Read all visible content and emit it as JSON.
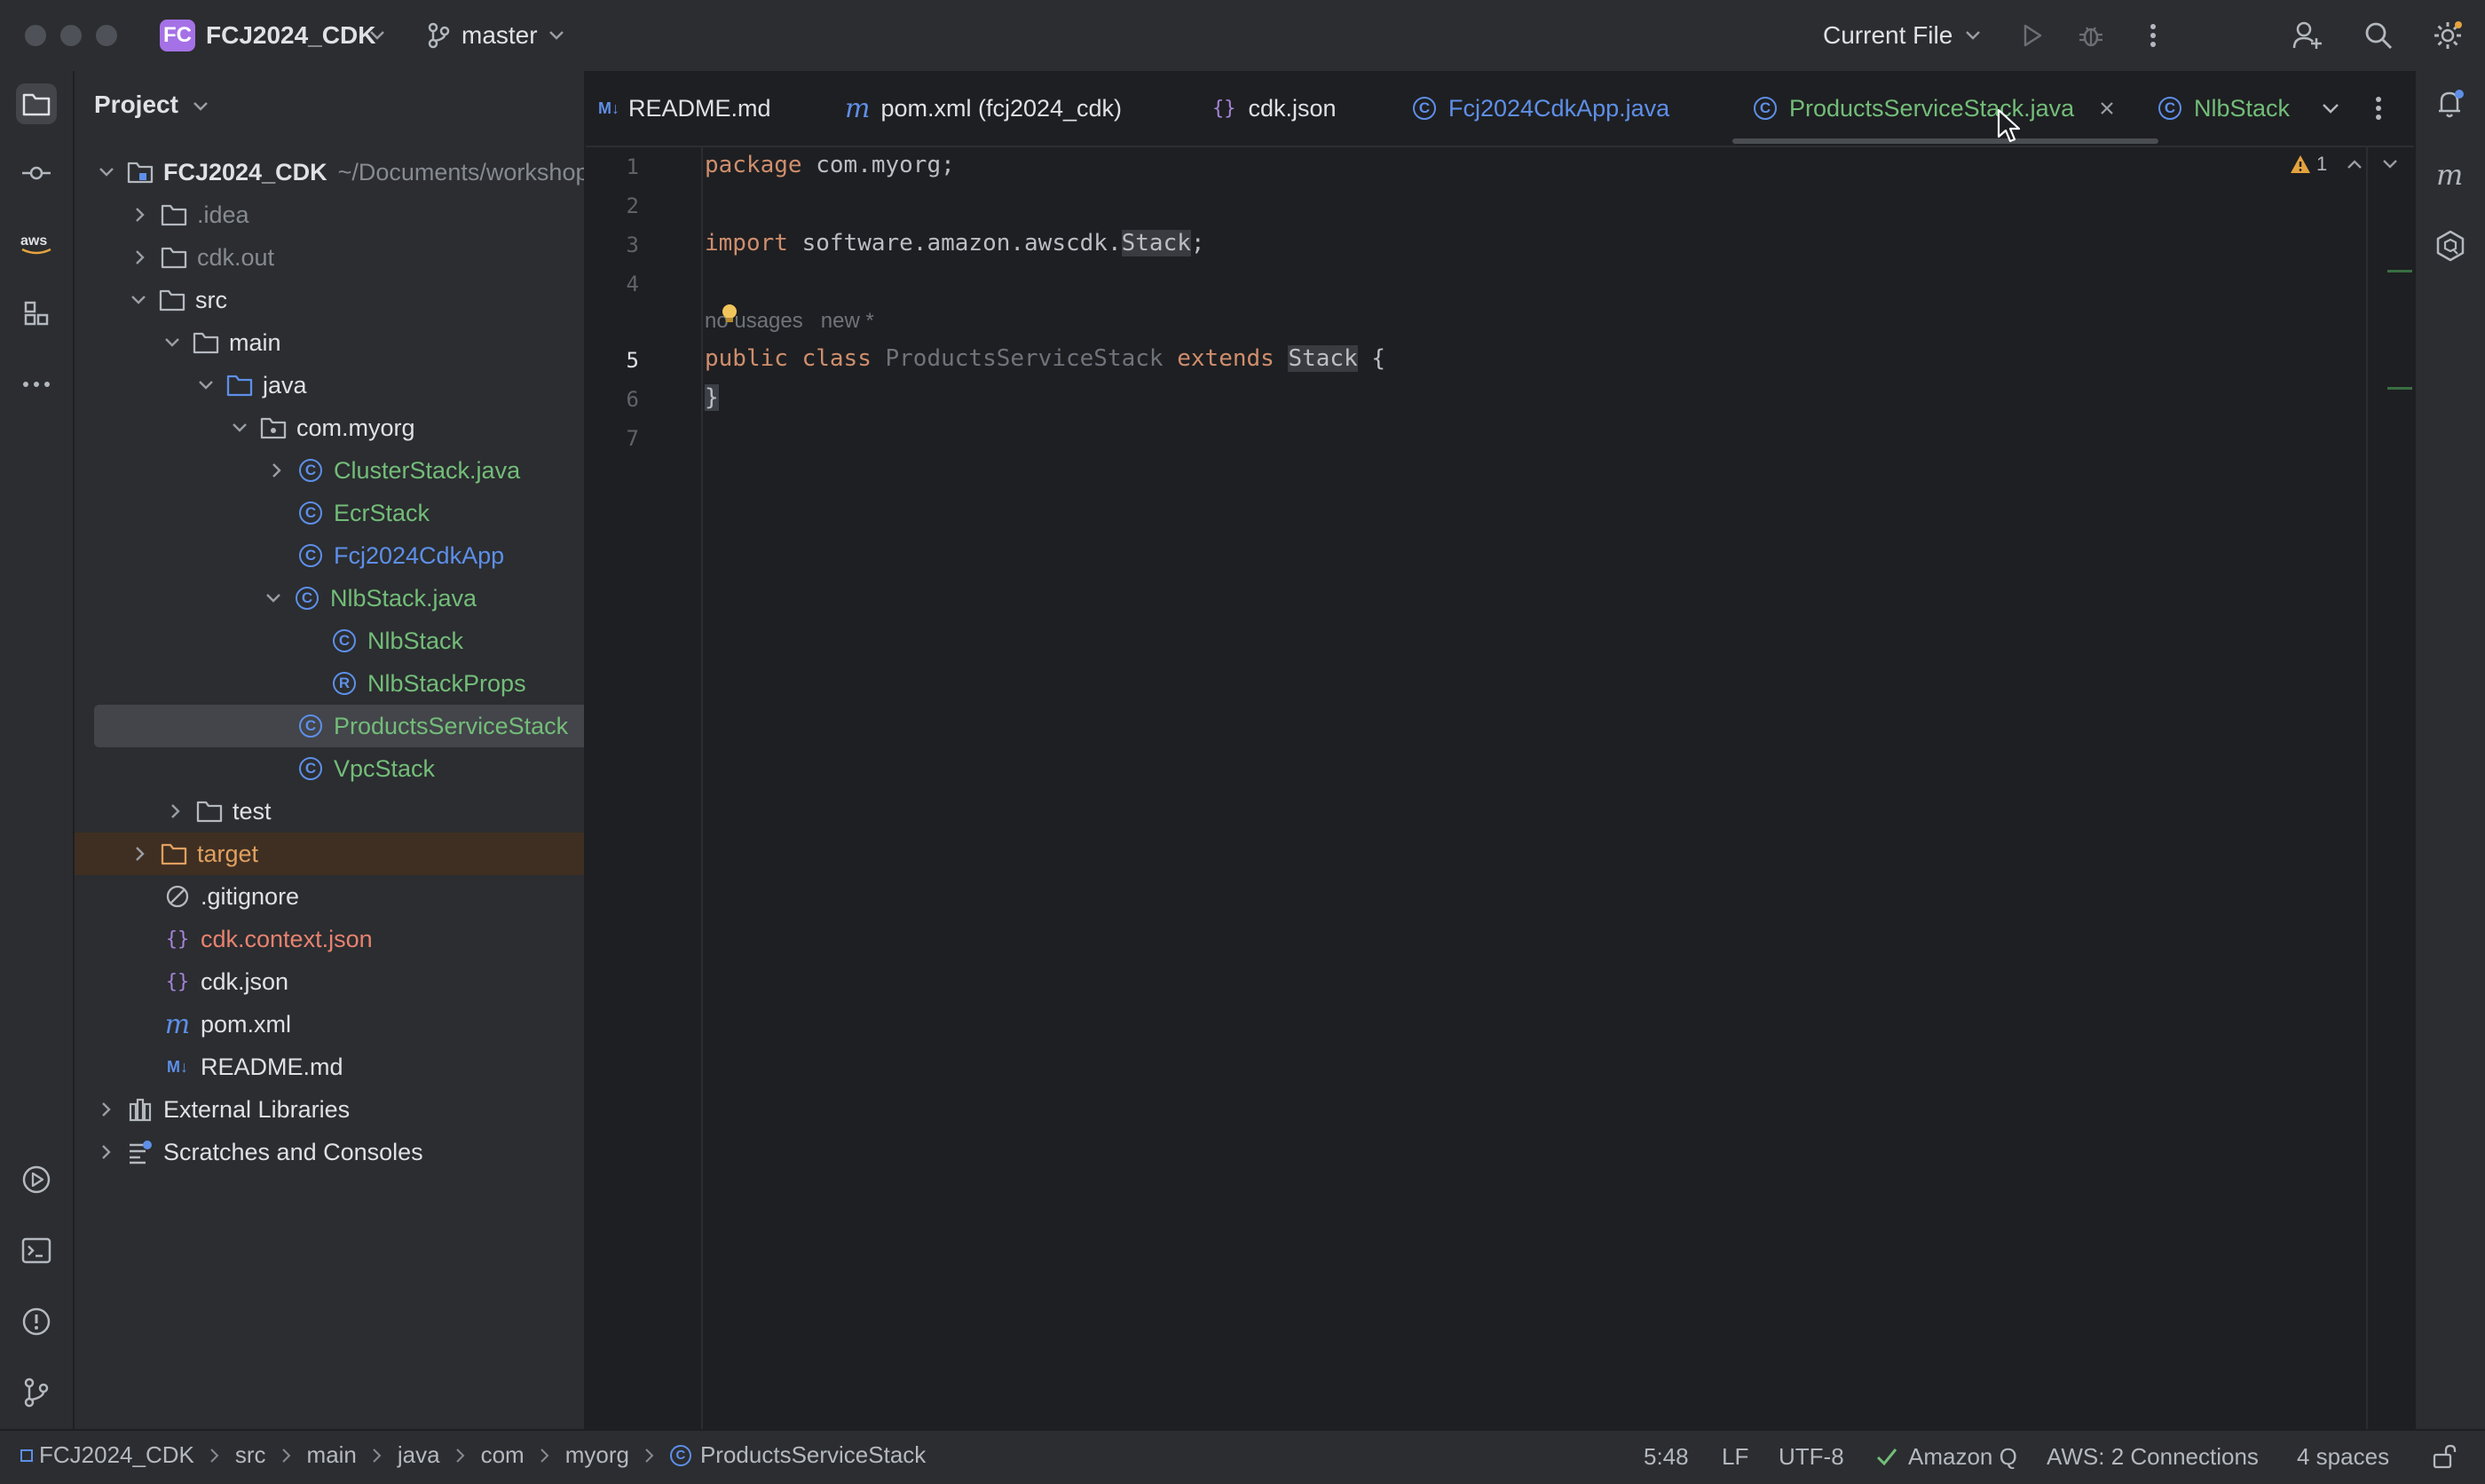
{
  "titlebar": {
    "project_badge": "FC",
    "project_name": "FCJ2024_CDK",
    "branch": "master",
    "run_config": "Current File"
  },
  "project_panel": {
    "title": "Project",
    "root_name": "FCJ2024_CDK",
    "root_path": "~/Documents/workshop",
    "items": [
      {
        "label": ".idea"
      },
      {
        "label": "cdk.out"
      },
      {
        "label": "src"
      },
      {
        "label": "main"
      },
      {
        "label": "java"
      },
      {
        "label": "com.myorg"
      },
      {
        "label": "ClusterStack.java"
      },
      {
        "label": "EcrStack"
      },
      {
        "label": "Fcj2024CdkApp"
      },
      {
        "label": "NlbStack.java"
      },
      {
        "label": "NlbStack"
      },
      {
        "label": "NlbStackProps"
      },
      {
        "label": "ProductsServiceStack"
      },
      {
        "label": "VpcStack"
      },
      {
        "label": "test"
      },
      {
        "label": "target"
      },
      {
        "label": ".gitignore"
      },
      {
        "label": "cdk.context.json"
      },
      {
        "label": "cdk.json"
      },
      {
        "label": "pom.xml"
      },
      {
        "label": "README.md"
      },
      {
        "label": "External Libraries"
      },
      {
        "label": "Scratches and Consoles"
      }
    ]
  },
  "tabs": [
    {
      "icon": "M↓",
      "label": "README.md"
    },
    {
      "icon": "m",
      "label": "pom.xml (fcj2024_cdk)"
    },
    {
      "icon": "{}",
      "label": "cdk.json"
    },
    {
      "icon": "C",
      "label": "Fcj2024CdkApp.java"
    },
    {
      "icon": "C",
      "label": "ProductsServiceStack.java"
    },
    {
      "icon": "C",
      "label": "NlbStack"
    }
  ],
  "editor": {
    "line_numbers": [
      "1",
      "2",
      "3",
      "4",
      "5",
      "6",
      "7"
    ],
    "code": {
      "l1_kw": "package",
      "l1_rest": " com.myorg;",
      "l3_kw": "import",
      "l3_pkg": " software.amazon.awscdk.",
      "l3_cls": "Stack",
      "l3_end": ";",
      "hint_usages": "no usages",
      "hint_new": "new *",
      "l5_public": "public",
      "l5_class": " class ",
      "l5_name": "ProductsServiceStack",
      "l5_extends": " extends ",
      "l5_stack": "Stack",
      "l5_brace": " {",
      "l6": "}"
    },
    "warning_count": "1"
  },
  "statusbar": {
    "breadcrumbs": [
      "FCJ2024_CDK",
      "src",
      "main",
      "java",
      "com",
      "myorg",
      "ProductsServiceStack"
    ],
    "position": "5:48",
    "line_sep": "LF",
    "encoding": "UTF-8",
    "amazon_q": "Amazon Q",
    "aws": "AWS: 2 Connections",
    "indent": "4 spaces"
  },
  "colors": {
    "background": "#1e1f22",
    "panel": "#2b2d30",
    "keyword": "#cf8e6d",
    "vcs_new_file": "#73bd79",
    "class_icon": "#5e8fe8",
    "project_badge": "#a571e6"
  }
}
